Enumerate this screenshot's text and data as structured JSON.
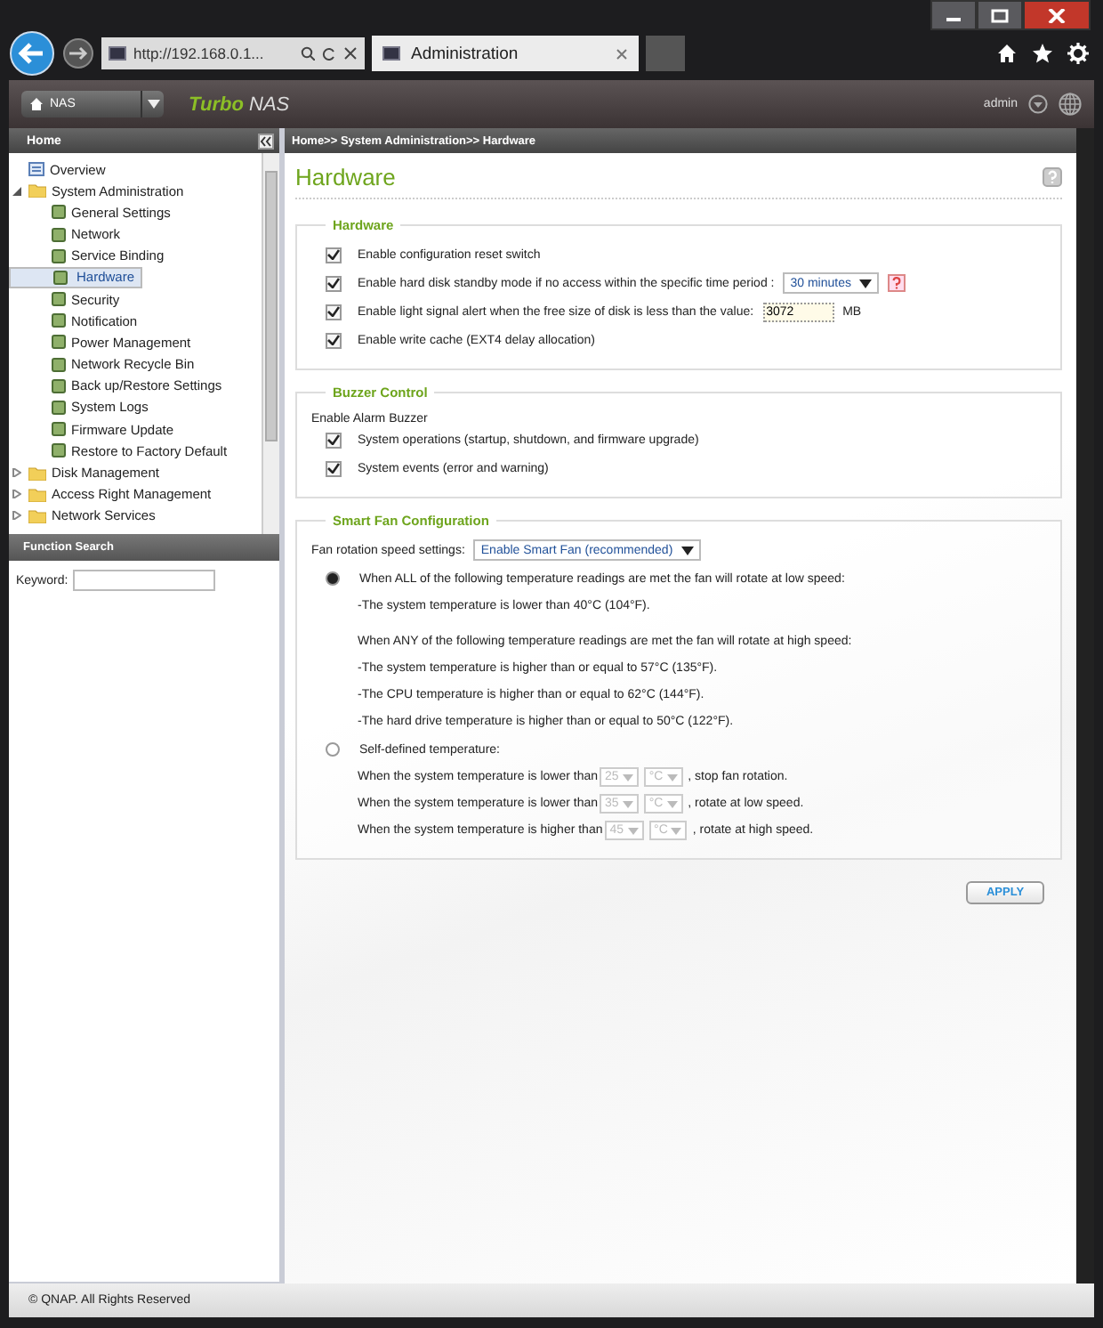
{
  "browser": {
    "address": "http://192.168.0.1...",
    "tab_title": "Administration"
  },
  "header": {
    "device_menu": "NAS",
    "product_accent": "Turbo",
    "product_name": "NAS",
    "user": "admin"
  },
  "sidebar": {
    "title": "Home",
    "tree": [
      {
        "kind": "page",
        "label": "Overview",
        "selected": false
      },
      {
        "kind": "folder",
        "label": "System Administration",
        "expanded": true,
        "selected": false,
        "children": [
          {
            "kind": "page",
            "label": "General Settings",
            "selected": false
          },
          {
            "kind": "page",
            "label": "Network",
            "selected": false
          },
          {
            "kind": "page",
            "label": "Service Binding",
            "selected": false
          },
          {
            "kind": "page",
            "label": "Hardware",
            "selected": true
          },
          {
            "kind": "page",
            "label": "Security",
            "selected": false
          },
          {
            "kind": "page",
            "label": "Notification",
            "selected": false
          },
          {
            "kind": "page",
            "label": "Power Management",
            "selected": false
          },
          {
            "kind": "page",
            "label": "Network Recycle Bin",
            "selected": false
          },
          {
            "kind": "page",
            "label": "Back up/Restore Settings",
            "selected": false
          },
          {
            "kind": "page",
            "label": "System Logs",
            "selected": false
          },
          {
            "kind": "page",
            "label": "Firmware Update",
            "selected": false
          },
          {
            "kind": "page",
            "label": "Restore to Factory Default",
            "selected": false
          }
        ]
      },
      {
        "kind": "folder",
        "label": "Disk Management",
        "expanded": false,
        "selected": false
      },
      {
        "kind": "folder",
        "label": "Access Right Management",
        "expanded": false,
        "selected": false
      },
      {
        "kind": "folder",
        "label": "Network Services",
        "expanded": false,
        "selected": false
      }
    ],
    "search": {
      "title": "Function Search",
      "label": "Keyword:"
    }
  },
  "breadcrumb": "Home>> System Administration>> Hardware",
  "page_title": "Hardware",
  "hardware": {
    "title": "Hardware",
    "options": [
      {
        "kind": "plain",
        "label": "Enable configuration reset switch",
        "checked": true
      },
      {
        "kind": "select",
        "label": "Enable hard disk standby mode if no access within the specific time period :",
        "checked": true,
        "value": "30 minutes"
      },
      {
        "kind": "input",
        "label": "Enable light signal alert when the free size of disk is less than the value:",
        "checked": true,
        "value": "3072",
        "suffix": "MB"
      },
      {
        "kind": "plain",
        "label": "Enable write cache (EXT4 delay allocation)",
        "checked": true
      }
    ]
  },
  "buzzer": {
    "title": "Buzzer Control",
    "intro": "Enable Alarm Buzzer",
    "options": [
      {
        "label": "System operations (startup, shutdown, and firmware upgrade)",
        "checked": true
      },
      {
        "label": "System events (error and warning)",
        "checked": true
      }
    ]
  },
  "fan": {
    "title": "Smart Fan Configuration",
    "setting_label": "Fan rotation speed settings:",
    "setting_value": "Enable Smart Fan (recommended)",
    "auto": {
      "selected": true,
      "label": "When ALL of the following temperature readings are met the fan will rotate at low speed:",
      "low_lines": [
        "-The system temperature is lower than 40°C (104°F)."
      ],
      "high_title": "When ANY of the following temperature readings are met the fan will rotate at high speed:",
      "high_lines": [
        "-The system temperature is higher than or equal to 57°C (135°F).",
        "-The CPU temperature is higher than or equal to 62°C (144°F).",
        "-The hard drive temperature is higher than or equal to 50°C (122°F)."
      ]
    },
    "manual": {
      "selected": false,
      "label": "Self-defined temperature:",
      "rules": [
        {
          "prefix": "When the system temperature is lower than",
          "value": "25",
          "unit": "°C",
          "suffix": ", stop fan rotation.",
          "disabled": true
        },
        {
          "prefix": "When the system temperature is lower than",
          "value": "35",
          "unit": "°C",
          "suffix": ", rotate at low speed.",
          "disabled": true
        },
        {
          "prefix": "When the system temperature is higher than",
          "value": "45",
          "unit": "°C",
          "suffix": ", rotate at high speed.",
          "disabled": true
        }
      ]
    }
  },
  "apply": "APPLY",
  "footer": "© QNAP. All Rights Reserved"
}
